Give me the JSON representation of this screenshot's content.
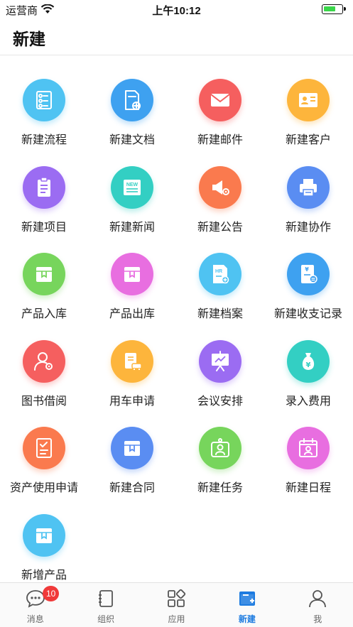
{
  "status_bar": {
    "carrier": "运营商",
    "time": "上午10:12",
    "battery_level": 0.7
  },
  "header": {
    "title": "新建"
  },
  "grid": {
    "items": [
      {
        "label": "新建流程",
        "icon": "flowchart-icon",
        "color": "#4fc3f2"
      },
      {
        "label": "新建文档",
        "icon": "document-add-icon",
        "color": "#3ea1f0"
      },
      {
        "label": "新建邮件",
        "icon": "mail-icon",
        "color": "#f55f5f"
      },
      {
        "label": "新建客户",
        "icon": "contact-card-icon",
        "color": "#fdb53c"
      },
      {
        "label": "新建项目",
        "icon": "clipboard-list-icon",
        "color": "#9b6cf2"
      },
      {
        "label": "新建新闻",
        "icon": "newspaper-icon",
        "color": "#33cfc3"
      },
      {
        "label": "新建公告",
        "icon": "megaphone-icon",
        "color": "#fa7a4e"
      },
      {
        "label": "新建协作",
        "icon": "printer-icon",
        "color": "#5a8df2"
      },
      {
        "label": "产品入库",
        "icon": "box-in-icon",
        "color": "#77d55c"
      },
      {
        "label": "产品出库",
        "icon": "box-out-icon",
        "color": "#e86ee0"
      },
      {
        "label": "新建档案",
        "icon": "hr-file-icon",
        "color": "#4fc3f2"
      },
      {
        "label": "新建收支记录",
        "icon": "ledger-icon",
        "color": "#3ea1f0"
      },
      {
        "label": "图书借阅",
        "icon": "user-gear-icon",
        "color": "#f55f5f"
      },
      {
        "label": "用车申请",
        "icon": "car-clipboard-icon",
        "color": "#fdb53c"
      },
      {
        "label": "会议安排",
        "icon": "presentation-board-icon",
        "color": "#9b6cf2"
      },
      {
        "label": "录入费用",
        "icon": "money-bag-icon",
        "color": "#33cfc3"
      },
      {
        "label": "资产使用申请",
        "icon": "checklist-icon",
        "color": "#fa7a4e"
      },
      {
        "label": "新建合同",
        "icon": "contract-box-icon",
        "color": "#5a8df2"
      },
      {
        "label": "新建任务",
        "icon": "task-badge-icon",
        "color": "#77d55c"
      },
      {
        "label": "新建日程",
        "icon": "calendar-user-icon",
        "color": "#e86ee0"
      },
      {
        "label": "新增产品",
        "icon": "product-box-icon",
        "color": "#4fc3f2"
      }
    ]
  },
  "tab_bar": {
    "tabs": [
      {
        "label": "消息",
        "icon": "chat-bubble-icon",
        "badge": "10"
      },
      {
        "label": "组织",
        "icon": "notebook-icon"
      },
      {
        "label": "应用",
        "icon": "app-grid-icon"
      },
      {
        "label": "新建",
        "icon": "new-window-icon",
        "active": true
      },
      {
        "label": "我",
        "icon": "person-icon"
      }
    ],
    "active_color": "#1d7be0"
  }
}
